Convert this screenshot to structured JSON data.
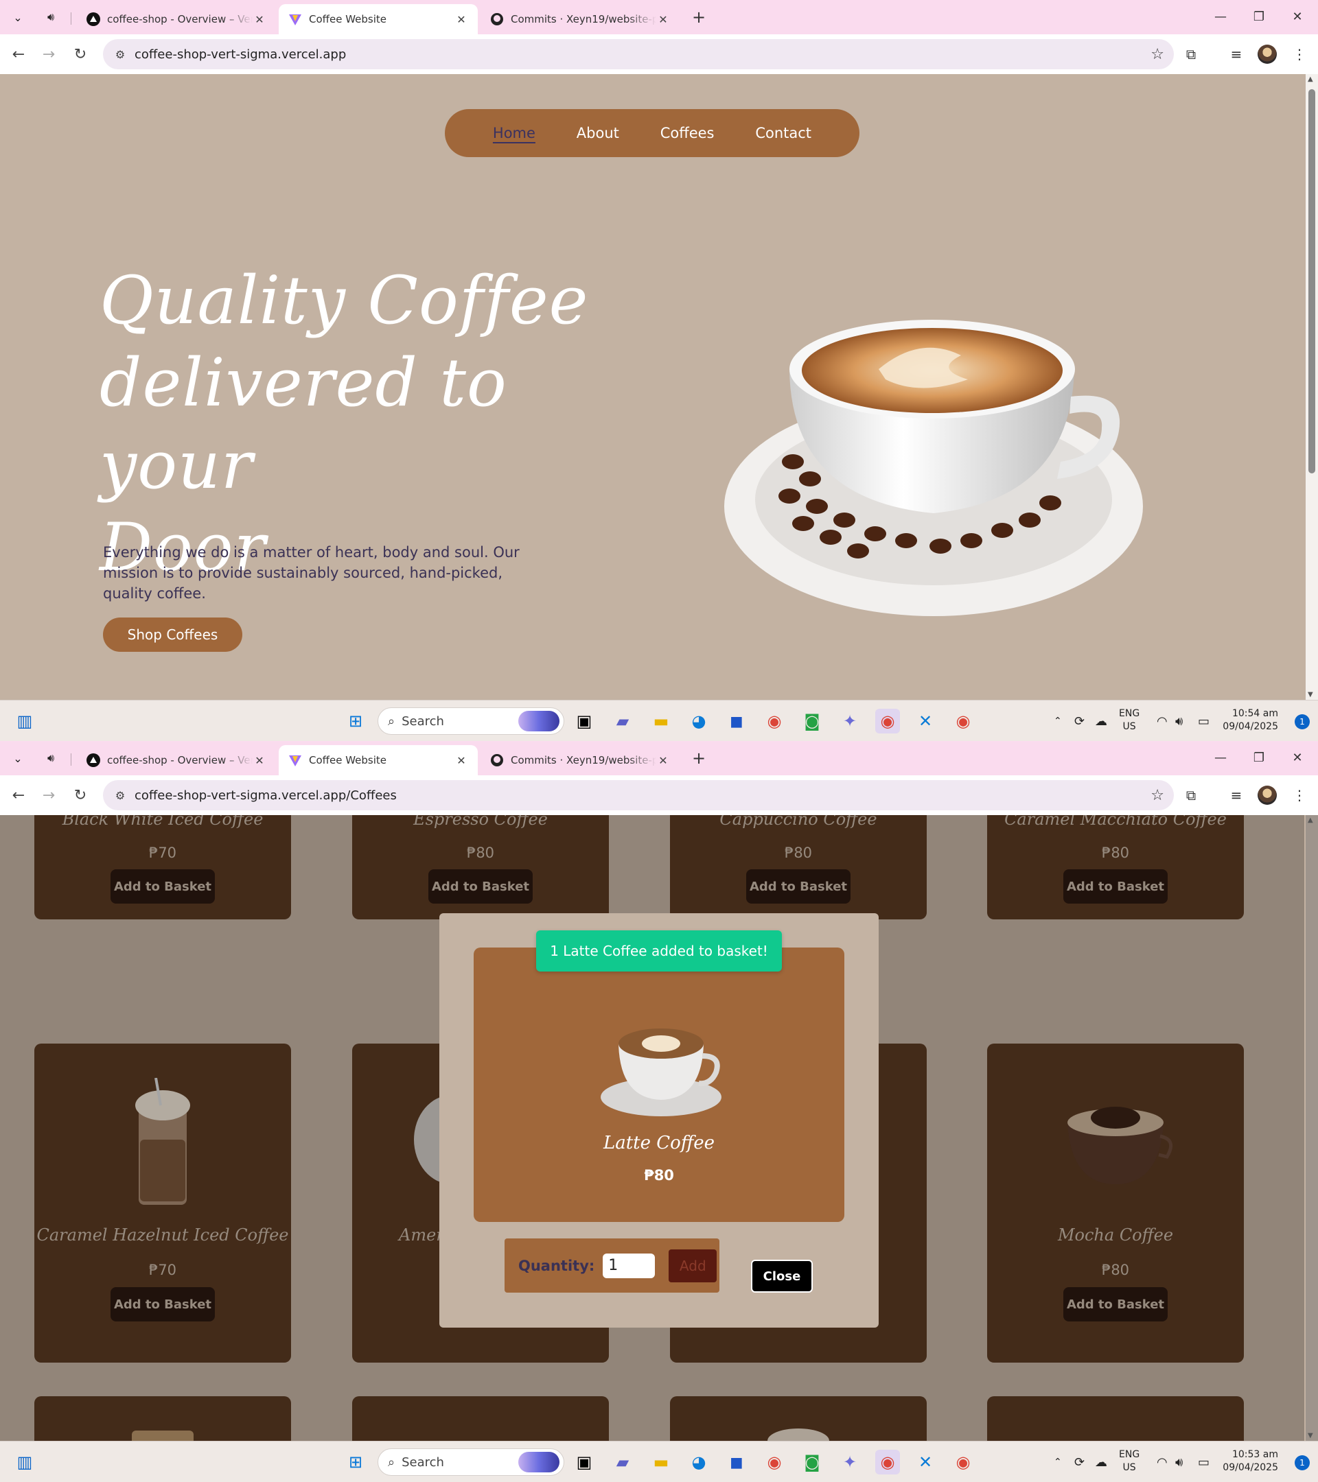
{
  "browser": {
    "tabs": [
      {
        "title": "coffee-shop - Overview – Vercel"
      },
      {
        "title": "Coffee Website"
      },
      {
        "title": "Commits · Xeyn19/website-portfolio"
      }
    ],
    "url_home": "coffee-shop-vert-sigma.vercel.app",
    "url_coffees": "coffee-shop-vert-sigma.vercel.app/Coffees"
  },
  "taskbar": {
    "search_placeholder": "Search",
    "lang_top": "ENG",
    "lang_bottom": "US",
    "time1": "10:54 am",
    "time2": "10:53 am",
    "date": "09/04/2025",
    "notif_count": "1"
  },
  "home": {
    "nav": {
      "home": "Home",
      "about": "About",
      "coffees": "Coffees",
      "contact": "Contact"
    },
    "title_line1": "Quality Coffee",
    "title_line2": "delivered to your",
    "title_line3": "Door",
    "description": "Everything we do is a matter of heart, body and soul. Our mission is to provide sustainably sourced, hand-picked, quality coffee.",
    "cta": "Shop Coffees"
  },
  "coffees": {
    "add_label": "Add to Basket",
    "top_row": [
      {
        "name": "Black White Iced Coffee",
        "price": "₱70"
      },
      {
        "name": "Espresso Coffee",
        "price": "₱80"
      },
      {
        "name": "Cappuccino Coffee",
        "price": "₱80"
      },
      {
        "name": "Caramel Macchiato Coffee",
        "price": "₱80"
      }
    ],
    "mid_row": [
      {
        "name": "Caramel Hazelnut Iced Coffee",
        "price": "₱70"
      },
      {
        "name": "Ameri",
        "price": ""
      },
      {
        "name": "",
        "price": ""
      },
      {
        "name": "Mocha Coffee",
        "price": "₱80"
      }
    ],
    "modal": {
      "toast": "1 Latte Coffee added to basket!",
      "name": "Latte Coffee",
      "price": "₱80",
      "qty_label": "Quantity:",
      "qty_value": "1",
      "add": "Add",
      "close": "Close"
    }
  }
}
